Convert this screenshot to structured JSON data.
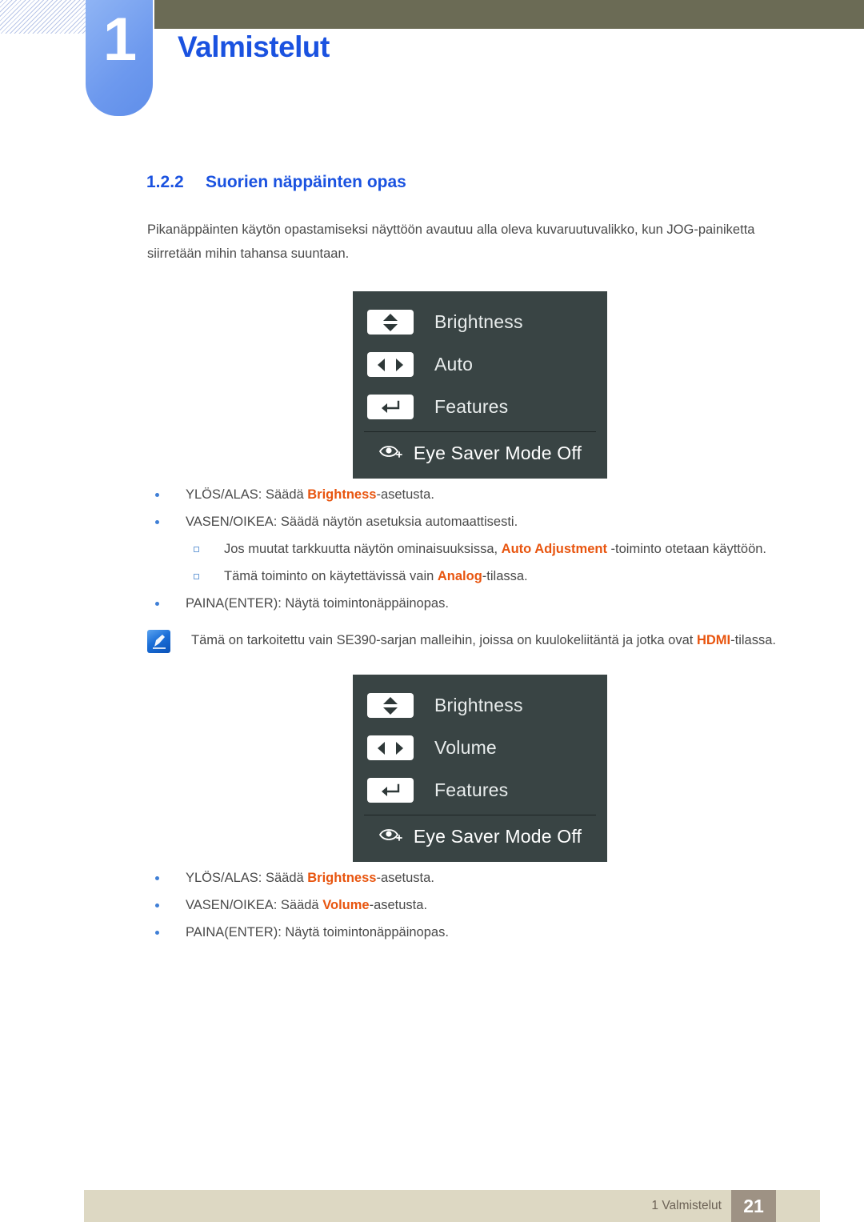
{
  "header": {
    "chapter_number": "1",
    "chapter_title": "Valmistelut",
    "bar_color": "#6b6b55",
    "tab_color": "#6d99ee",
    "title_color": "#1a52e0"
  },
  "section": {
    "number": "1.2.2",
    "title": "Suorien näppäinten opas",
    "intro": "Pikanäppäinten käytön opastamiseksi näyttöön avautuu alla oleva kuvaruutuvalikko, kun JOG-painiketta siirretään mihin tahansa suuntaan."
  },
  "osd_menu_1": {
    "background_color": "#394444",
    "rows": [
      {
        "icon": "up-down-arrows-icon",
        "label": "Brightness"
      },
      {
        "icon": "left-right-arrows-icon",
        "label": "Auto"
      },
      {
        "icon": "enter-arrow-icon",
        "label": "Features"
      }
    ],
    "footer": {
      "icon": "eye-saver-icon",
      "label": "Eye Saver Mode Off"
    }
  },
  "osd_menu_2": {
    "background_color": "#394444",
    "rows": [
      {
        "icon": "up-down-arrows-icon",
        "label": "Brightness"
      },
      {
        "icon": "left-right-arrows-icon",
        "label": "Volume"
      },
      {
        "icon": "enter-arrow-icon",
        "label": "Features"
      }
    ],
    "footer": {
      "icon": "eye-saver-icon",
      "label": "Eye Saver Mode Off"
    }
  },
  "bullets_1": [
    {
      "level": 1,
      "parts": [
        {
          "text": "YLÖS/ALAS: Säädä ",
          "keyword": false
        },
        {
          "text": "Brightness",
          "keyword": true
        },
        {
          "text": "-asetusta.",
          "keyword": false
        }
      ]
    },
    {
      "level": 1,
      "parts": [
        {
          "text": "VASEN/OIKEA: Säädä näytön asetuksia automaattisesti.",
          "keyword": false
        }
      ]
    },
    {
      "level": 2,
      "parts": [
        {
          "text": "Jos muutat tarkkuutta näytön ominaisuuksissa, ",
          "keyword": false
        },
        {
          "text": "Auto Adjustment",
          "keyword": true
        },
        {
          "text": " -toiminto otetaan käyttöön.",
          "keyword": false
        }
      ]
    },
    {
      "level": 2,
      "parts": [
        {
          "text": "Tämä toiminto on käytettävissä vain ",
          "keyword": false
        },
        {
          "text": "Analog",
          "keyword": true
        },
        {
          "text": "-tilassa.",
          "keyword": false
        }
      ]
    },
    {
      "level": 1,
      "parts": [
        {
          "text": "PAINA(ENTER): Näytä toimintonäppäinopas.",
          "keyword": false
        }
      ]
    }
  ],
  "note": {
    "icon": "note-pen-icon",
    "parts": [
      {
        "text": "Tämä on tarkoitettu vain SE390-sarjan malleihin, joissa on kuulokeliitäntä ja jotka ovat ",
        "keyword": false
      },
      {
        "text": "HDMI",
        "keyword": true
      },
      {
        "text": "-tilassa.",
        "keyword": false
      }
    ]
  },
  "bullets_2": [
    {
      "level": 1,
      "parts": [
        {
          "text": "YLÖS/ALAS: Säädä ",
          "keyword": false
        },
        {
          "text": "Brightness",
          "keyword": true
        },
        {
          "text": "-asetusta.",
          "keyword": false
        }
      ]
    },
    {
      "level": 1,
      "parts": [
        {
          "text": "VASEN/OIKEA: Säädä ",
          "keyword": false
        },
        {
          "text": "Volume",
          "keyword": true
        },
        {
          "text": "-asetusta.",
          "keyword": false
        }
      ]
    },
    {
      "level": 1,
      "parts": [
        {
          "text": "PAINA(ENTER): Näytä toimintonäppäinopas.",
          "keyword": false
        }
      ]
    }
  ],
  "footer": {
    "label": "1 Valmistelut",
    "page_number": "21",
    "bar_color": "#ddd8c3",
    "page_box_color": "#9e9284"
  },
  "colors": {
    "keyword": "#e8550f",
    "body_text": "#4a4a4a",
    "heading": "#1a52e0",
    "bullet": "#3f7fd6"
  }
}
